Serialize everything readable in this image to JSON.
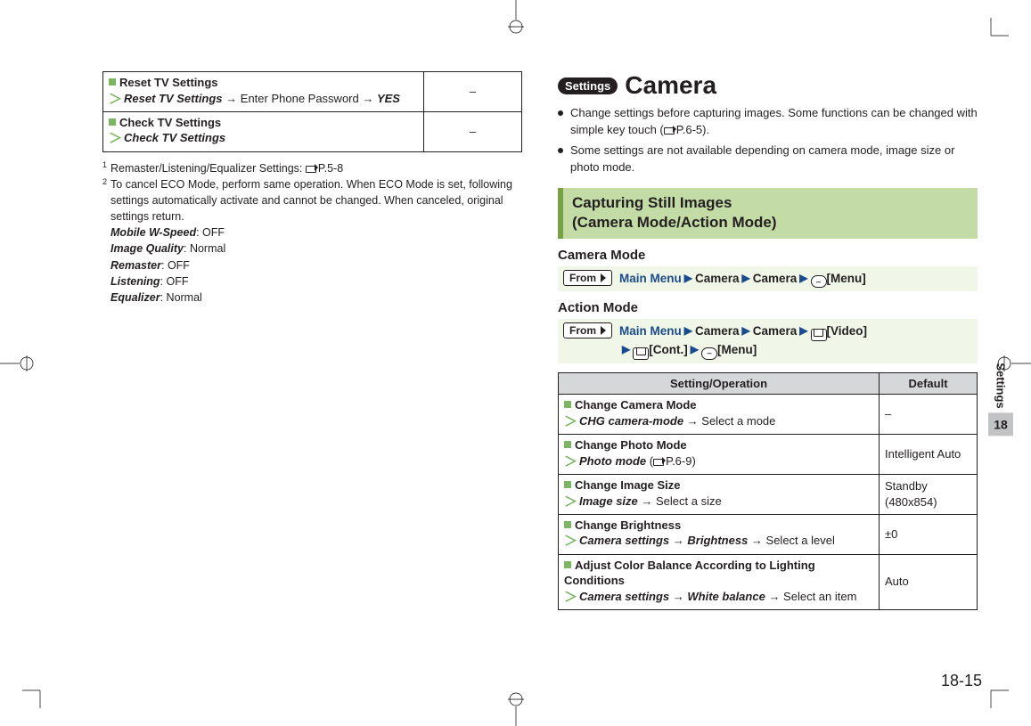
{
  "leftTable": {
    "rows": [
      {
        "title": "Reset TV Settings",
        "op_prefix": "Reset TV Settings",
        "op_mid": " → Enter Phone Password → ",
        "op_suffix": "YES",
        "default": "–"
      },
      {
        "title": "Check TV Settings",
        "op_prefix": "Check TV Settings",
        "op_mid": "",
        "op_suffix": "",
        "default": "–"
      }
    ]
  },
  "footnotes": {
    "f1_pre": "Remaster/Listening/Equalizer Settings: ",
    "f1_ref": "P.5-8",
    "f2_a": "To cancel ECO Mode, perform same operation. When ECO Mode is set, following settings automatically activate and cannot be changed. When canceled, original settings return.",
    "lines": [
      {
        "k": "Mobile W-Speed",
        "v": ": OFF"
      },
      {
        "k": "Image Quality",
        "v": ": Normal"
      },
      {
        "k": "Remaster",
        "v": ": OFF"
      },
      {
        "k": "Listening",
        "v": ": OFF"
      },
      {
        "k": "Equalizer",
        "v": ": Normal"
      }
    ]
  },
  "right": {
    "pill": "Settings",
    "h1": "Camera",
    "bullets": [
      {
        "pre": "Change settings before capturing images. Some functions can be changed with simple key touch (",
        "ref": "P.6-5",
        "post": ")."
      },
      {
        "pre": "Some settings are not available depending on camera mode, image size or photo mode.",
        "ref": "",
        "post": ""
      }
    ],
    "section": "Capturing Still Images \n(Camera Mode/Action Mode)",
    "mode1": "Camera Mode",
    "mode2": "Action Mode",
    "from_label": "From",
    "nav1": {
      "a": "Main Menu",
      "b": "Camera",
      "c": "Camera",
      "d": "[Menu]"
    },
    "nav2": {
      "a": "Main Menu",
      "b": "Camera",
      "c": "Camera",
      "d": "[Video]",
      "e": "[Cont.]",
      "f": "[Menu]"
    },
    "tableHead": {
      "a": "Setting/Operation",
      "b": "Default"
    },
    "rows": [
      {
        "title": "Change Camera Mode",
        "op1": "CHG camera-mode",
        "mid": " → Select a mode",
        "op2": "",
        "tail": "",
        "ref": "",
        "def": "–"
      },
      {
        "title": "Change Photo Mode",
        "op1": "Photo mode",
        "mid": " (",
        "op2": "",
        "tail": ")",
        "ref": "P.6-9",
        "def": "Intelligent Auto"
      },
      {
        "title": "Change Image Size",
        "op1": "Image size",
        "mid": " → Select a size",
        "op2": "",
        "tail": "",
        "ref": "",
        "def": "Standby (480x854)"
      },
      {
        "title": "Change Brightness",
        "op1": "Camera settings",
        "mid": " → ",
        "op2": "Brightness",
        "tail": " → Select a level",
        "ref": "",
        "def": "±0"
      },
      {
        "title": "Adjust Color Balance According to Lighting Conditions",
        "op1": "Camera settings",
        "mid": " → ",
        "op2": "White balance",
        "tail": " → Select an item",
        "ref": "",
        "def": "Auto"
      }
    ]
  },
  "edge": {
    "label": "Settings",
    "num": "18"
  },
  "pageNum": "18-15"
}
